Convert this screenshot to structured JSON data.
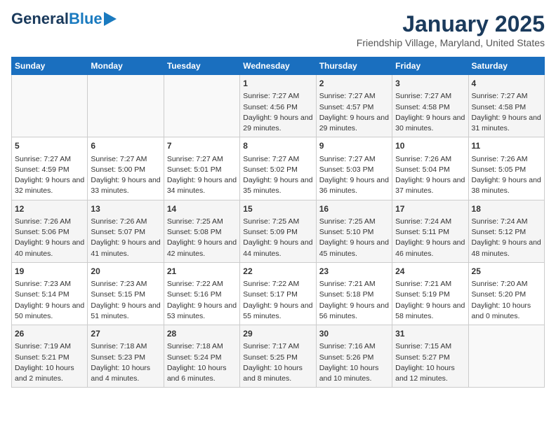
{
  "header": {
    "logo_line1": "General",
    "logo_line2": "Blue",
    "month": "January 2025",
    "location": "Friendship Village, Maryland, United States"
  },
  "days_of_week": [
    "Sunday",
    "Monday",
    "Tuesday",
    "Wednesday",
    "Thursday",
    "Friday",
    "Saturday"
  ],
  "weeks": [
    [
      {
        "day": "",
        "info": ""
      },
      {
        "day": "",
        "info": ""
      },
      {
        "day": "",
        "info": ""
      },
      {
        "day": "1",
        "info": "Sunrise: 7:27 AM\nSunset: 4:56 PM\nDaylight: 9 hours and 29 minutes."
      },
      {
        "day": "2",
        "info": "Sunrise: 7:27 AM\nSunset: 4:57 PM\nDaylight: 9 hours and 29 minutes."
      },
      {
        "day": "3",
        "info": "Sunrise: 7:27 AM\nSunset: 4:58 PM\nDaylight: 9 hours and 30 minutes."
      },
      {
        "day": "4",
        "info": "Sunrise: 7:27 AM\nSunset: 4:58 PM\nDaylight: 9 hours and 31 minutes."
      }
    ],
    [
      {
        "day": "5",
        "info": "Sunrise: 7:27 AM\nSunset: 4:59 PM\nDaylight: 9 hours and 32 minutes."
      },
      {
        "day": "6",
        "info": "Sunrise: 7:27 AM\nSunset: 5:00 PM\nDaylight: 9 hours and 33 minutes."
      },
      {
        "day": "7",
        "info": "Sunrise: 7:27 AM\nSunset: 5:01 PM\nDaylight: 9 hours and 34 minutes."
      },
      {
        "day": "8",
        "info": "Sunrise: 7:27 AM\nSunset: 5:02 PM\nDaylight: 9 hours and 35 minutes."
      },
      {
        "day": "9",
        "info": "Sunrise: 7:27 AM\nSunset: 5:03 PM\nDaylight: 9 hours and 36 minutes."
      },
      {
        "day": "10",
        "info": "Sunrise: 7:26 AM\nSunset: 5:04 PM\nDaylight: 9 hours and 37 minutes."
      },
      {
        "day": "11",
        "info": "Sunrise: 7:26 AM\nSunset: 5:05 PM\nDaylight: 9 hours and 38 minutes."
      }
    ],
    [
      {
        "day": "12",
        "info": "Sunrise: 7:26 AM\nSunset: 5:06 PM\nDaylight: 9 hours and 40 minutes."
      },
      {
        "day": "13",
        "info": "Sunrise: 7:26 AM\nSunset: 5:07 PM\nDaylight: 9 hours and 41 minutes."
      },
      {
        "day": "14",
        "info": "Sunrise: 7:25 AM\nSunset: 5:08 PM\nDaylight: 9 hours and 42 minutes."
      },
      {
        "day": "15",
        "info": "Sunrise: 7:25 AM\nSunset: 5:09 PM\nDaylight: 9 hours and 44 minutes."
      },
      {
        "day": "16",
        "info": "Sunrise: 7:25 AM\nSunset: 5:10 PM\nDaylight: 9 hours and 45 minutes."
      },
      {
        "day": "17",
        "info": "Sunrise: 7:24 AM\nSunset: 5:11 PM\nDaylight: 9 hours and 46 minutes."
      },
      {
        "day": "18",
        "info": "Sunrise: 7:24 AM\nSunset: 5:12 PM\nDaylight: 9 hours and 48 minutes."
      }
    ],
    [
      {
        "day": "19",
        "info": "Sunrise: 7:23 AM\nSunset: 5:14 PM\nDaylight: 9 hours and 50 minutes."
      },
      {
        "day": "20",
        "info": "Sunrise: 7:23 AM\nSunset: 5:15 PM\nDaylight: 9 hours and 51 minutes."
      },
      {
        "day": "21",
        "info": "Sunrise: 7:22 AM\nSunset: 5:16 PM\nDaylight: 9 hours and 53 minutes."
      },
      {
        "day": "22",
        "info": "Sunrise: 7:22 AM\nSunset: 5:17 PM\nDaylight: 9 hours and 55 minutes."
      },
      {
        "day": "23",
        "info": "Sunrise: 7:21 AM\nSunset: 5:18 PM\nDaylight: 9 hours and 56 minutes."
      },
      {
        "day": "24",
        "info": "Sunrise: 7:21 AM\nSunset: 5:19 PM\nDaylight: 9 hours and 58 minutes."
      },
      {
        "day": "25",
        "info": "Sunrise: 7:20 AM\nSunset: 5:20 PM\nDaylight: 10 hours and 0 minutes."
      }
    ],
    [
      {
        "day": "26",
        "info": "Sunrise: 7:19 AM\nSunset: 5:21 PM\nDaylight: 10 hours and 2 minutes."
      },
      {
        "day": "27",
        "info": "Sunrise: 7:18 AM\nSunset: 5:23 PM\nDaylight: 10 hours and 4 minutes."
      },
      {
        "day": "28",
        "info": "Sunrise: 7:18 AM\nSunset: 5:24 PM\nDaylight: 10 hours and 6 minutes."
      },
      {
        "day": "29",
        "info": "Sunrise: 7:17 AM\nSunset: 5:25 PM\nDaylight: 10 hours and 8 minutes."
      },
      {
        "day": "30",
        "info": "Sunrise: 7:16 AM\nSunset: 5:26 PM\nDaylight: 10 hours and 10 minutes."
      },
      {
        "day": "31",
        "info": "Sunrise: 7:15 AM\nSunset: 5:27 PM\nDaylight: 10 hours and 12 minutes."
      },
      {
        "day": "",
        "info": ""
      }
    ]
  ]
}
